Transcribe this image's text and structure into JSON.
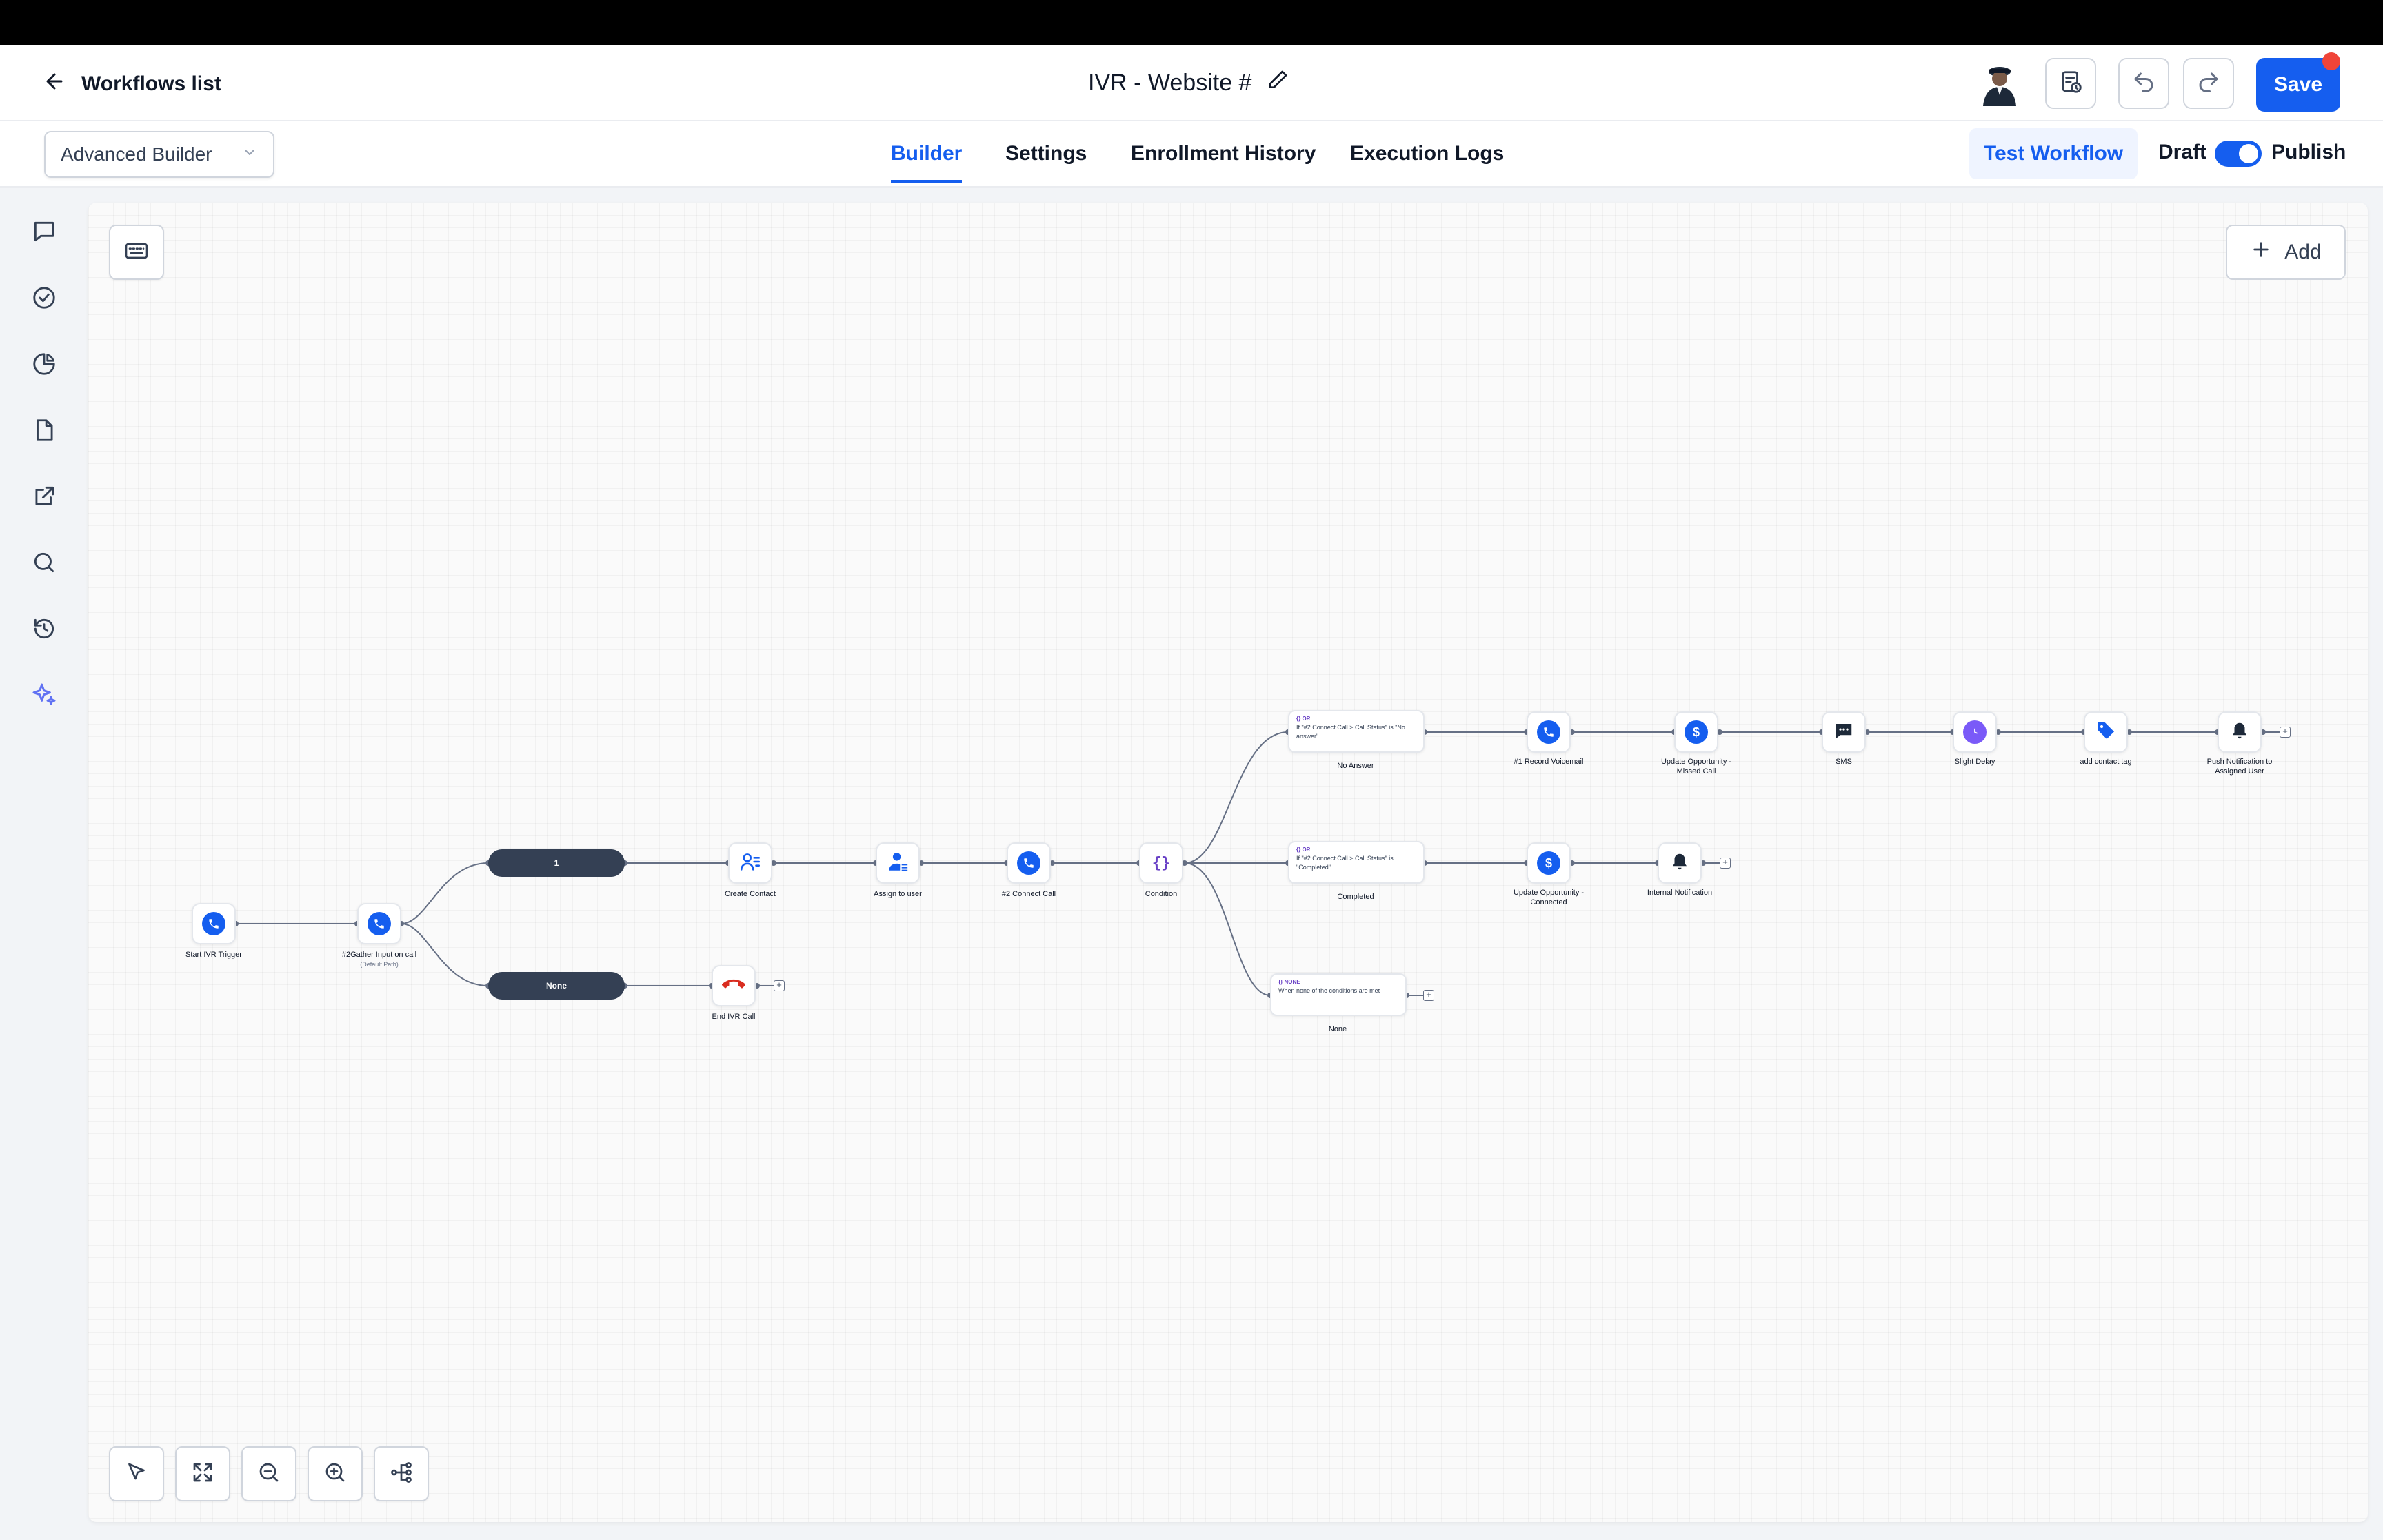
{
  "header": {
    "back_label": "Workflows list",
    "workflow_title": "IVR - Website #",
    "save_label": "Save"
  },
  "subheader": {
    "builder_select": "Advanced Builder",
    "tabs": [
      "Builder",
      "Settings",
      "Enrollment History",
      "Execution Logs"
    ],
    "active_tab": "Builder",
    "test_label": "Test Workflow",
    "draft_label": "Draft",
    "publish_label": "Publish",
    "publish_enabled": true
  },
  "sidebar_icons": [
    "chat-icon",
    "check-circle-icon",
    "pie-chart-icon",
    "file-icon",
    "external-link-icon",
    "search-icon",
    "history-icon",
    "sparkle-icon"
  ],
  "canvas": {
    "add_label": "Add",
    "nodes": {
      "start": "Start IVR Trigger",
      "gather": "#2Gather Input on call",
      "gather_sub": "(Default Path)",
      "branch_1": "1",
      "branch_none": "None",
      "end_ivr": "End IVR Call",
      "create_contact": "Create Contact",
      "assign_user": "Assign to user",
      "connect_call": "#2 Connect Call",
      "condition": "Condition",
      "cond_no_answer_tag": "{} OR",
      "cond_no_answer_text": "If \"#2 Connect Call > Call Status\" is \"No answer\"",
      "cond_no_answer_label": "No Answer",
      "cond_completed_tag": "{} OR",
      "cond_completed_text": "If \"#2 Connect Call > Call Status\" is \"Completed\"",
      "cond_completed_label": "Completed",
      "cond_none_tag": "{} NONE",
      "cond_none_text": "When none of the conditions are met",
      "cond_none_label": "None",
      "record_voicemail": "#1 Record Voicemail",
      "update_missed": "Update Opportunity - Missed Call",
      "sms": "SMS",
      "slight_delay": "Slight Delay",
      "add_tag": "add contact tag",
      "push_notification": "Push Notification to Assigned User",
      "update_connected": "Update Opportunity - Connected",
      "internal_notification": "Internal Notification"
    }
  },
  "colors": {
    "primary": "#155eef",
    "pill": "#344054",
    "end_call": "#d92d20",
    "delay": "#7a5af8",
    "sparkle": "#6172f3"
  }
}
